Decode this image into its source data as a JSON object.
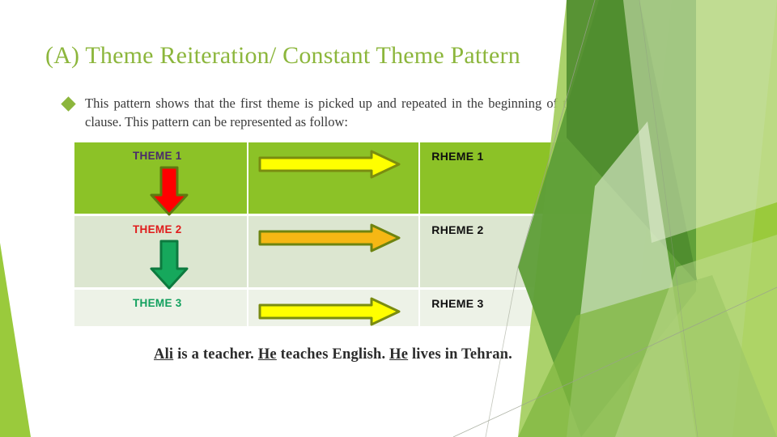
{
  "slide": {
    "title": "(A) Theme Reiteration/ Constant Theme Pattern",
    "title_color": "#8CB63C",
    "background_color": "#FFFFFF",
    "bullet_icon": "diamond-bullet",
    "body_text": "This pattern shows that the first theme is picked up and repeated in the beginning of the next clause. This pattern can be represented as follow:"
  },
  "table": {
    "rows": [
      {
        "theme": "THEME 1",
        "theme_color": "#4A2A6B",
        "rheme": "RHEME 1",
        "rheme_color": "#0F0F0F",
        "row_fill": "#8CC227",
        "h_arrow_icon": "right-arrow-icon",
        "h_arrow_color": "#FFFF00",
        "h_arrow_outline": "#7A8C10",
        "v_arrow_icon": "down-arrow-icon",
        "v_arrow_color": "#FF0000",
        "v_arrow_outline": "#5E7A10"
      },
      {
        "theme": "THEME 2",
        "theme_color": "#E01B1B",
        "rheme": "RHEME 2",
        "rheme_color": "#0F0F0F",
        "row_fill": "#DCE6D0",
        "h_arrow_icon": "right-arrow-icon",
        "h_arrow_color": "#F5B714",
        "h_arrow_outline": "#6E8410",
        "v_arrow_icon": "down-arrow-icon",
        "v_arrow_color": "#16A85C",
        "v_arrow_outline": "#0D7A3F"
      },
      {
        "theme": "THEME 3",
        "theme_color": "#12A05E",
        "rheme": "RHEME 3",
        "rheme_color": "#0F0F0F",
        "row_fill": "#EDF2E7",
        "h_arrow_icon": "right-arrow-icon",
        "h_arrow_color": "#FFFF00",
        "h_arrow_outline": "#7A8C10",
        "v_arrow_icon": "none",
        "v_arrow_color": "",
        "v_arrow_outline": ""
      }
    ]
  },
  "footer": {
    "segments": [
      {
        "text": "Ali",
        "underline": true
      },
      {
        "text": " is a teacher. ",
        "underline": false
      },
      {
        "text": "He",
        "underline": true
      },
      {
        "text": " teaches English. ",
        "underline": false
      },
      {
        "text": "He",
        "underline": true
      },
      {
        "text": " lives in Tehran.",
        "underline": false
      }
    ],
    "full_text": "Ali is a teacher. He teaches English. He lives in Tehran."
  },
  "decoration": {
    "type": "geometric-green-triangles",
    "palette": [
      "#8CC63F",
      "#5A9E32",
      "#76B043",
      "#A4CE5E",
      "#D7E7BE",
      "#EDF4E0",
      "#9ACA3C"
    ]
  }
}
